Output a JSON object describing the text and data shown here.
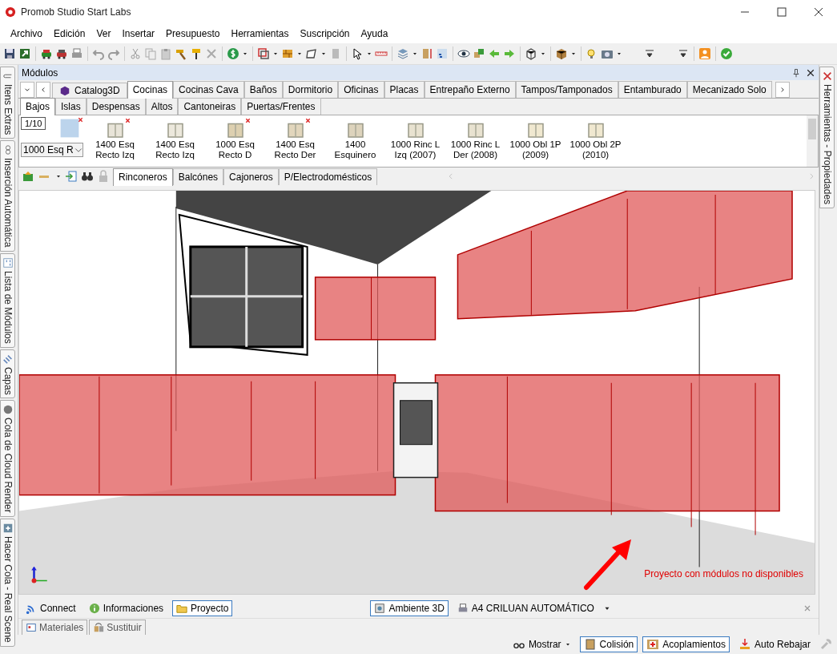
{
  "window": {
    "title": "Promob Studio Start Labs"
  },
  "menu": [
    "Archivo",
    "Edición",
    "Ver",
    "Insertar",
    "Presupuesto",
    "Herramientas",
    "Suscripción",
    "Ayuda"
  ],
  "left_tabs": [
    "Itens Extras",
    "Inserción Automática",
    "Lista de Módulos",
    "Capas",
    "Cola de Cloud Render",
    "Hacer Cola - Real Scene"
  ],
  "right_tabs": [
    "Herramientas - Propiedades"
  ],
  "modules_panel": {
    "title": "Módulos",
    "catalog": "Catalog3D",
    "tabs": [
      {
        "label": "Cocinas",
        "selected": true
      },
      {
        "label": "Cocinas Cava",
        "selected": false
      },
      {
        "label": "Baños",
        "selected": false
      },
      {
        "label": "Dormitorio",
        "selected": false
      },
      {
        "label": "Oficinas",
        "selected": false
      },
      {
        "label": "Placas",
        "selected": false
      },
      {
        "label": "Entrepaño Externo",
        "selected": false
      },
      {
        "label": "Tampos/Tamponados",
        "selected": false
      },
      {
        "label": "Entamburado",
        "selected": false
      },
      {
        "label": "Mecanizado Solo",
        "selected": false
      }
    ],
    "subtabs": [
      {
        "label": "Bajos",
        "selected": true
      },
      {
        "label": "Islas",
        "selected": false
      },
      {
        "label": "Despensas",
        "selected": false
      },
      {
        "label": "Altos",
        "selected": false
      },
      {
        "label": "Cantoneiras",
        "selected": false
      },
      {
        "label": "Puertas/Frentes",
        "selected": false
      }
    ],
    "selector": {
      "page": "1/10",
      "value": "1000 Esq R",
      "unavailable": true
    },
    "items": [
      {
        "label": "1400 Esq Recto Izq",
        "unavailable": true
      },
      {
        "label": "1400 Esq Recto Izq",
        "unavailable": false
      },
      {
        "label": "1000 Esq Recto D",
        "unavailable": true
      },
      {
        "label": "1400 Esq Recto Der",
        "unavailable": true
      },
      {
        "label": "1400 Esquinero",
        "unavailable": false
      },
      {
        "label": "1000 Rinc L Izq (2007)",
        "unavailable": false
      },
      {
        "label": "1000 Rinc L Der (2008)",
        "unavailable": false
      },
      {
        "label": "1000 Obl 1P (2009)",
        "unavailable": false
      },
      {
        "label": "1000 Obl 2P (2010)",
        "unavailable": false
      }
    ],
    "group_tabs": [
      {
        "label": "Rinconeros",
        "selected": true
      },
      {
        "label": "Balcónes",
        "selected": false
      },
      {
        "label": "Cajoneros",
        "selected": false
      },
      {
        "label": "P/Electrodomésticos",
        "selected": false
      }
    ]
  },
  "viewport": {
    "warning": "Proyecto con módulos no disponibles"
  },
  "bottom_tabs": [
    {
      "label": "Connect",
      "selected": false
    },
    {
      "label": "Informaciones",
      "selected": false
    },
    {
      "label": "Proyecto",
      "selected": true
    }
  ],
  "view_tabs": [
    {
      "label": "Ambiente 3D",
      "selected": true
    },
    {
      "label": "A4 CRILUAN AUTOMÁTICO",
      "selected": false
    }
  ],
  "panel_tabs": [
    "Materiales",
    "Sustituir"
  ],
  "status_bar": [
    {
      "label": "Mostrar",
      "kind": "dropdown"
    },
    {
      "label": "Colisión",
      "kind": "toggle",
      "on": true
    },
    {
      "label": "Acoplamientos",
      "kind": "toggle",
      "on": true
    },
    {
      "label": "Auto Rebajar",
      "kind": "toggle",
      "on": false
    }
  ]
}
